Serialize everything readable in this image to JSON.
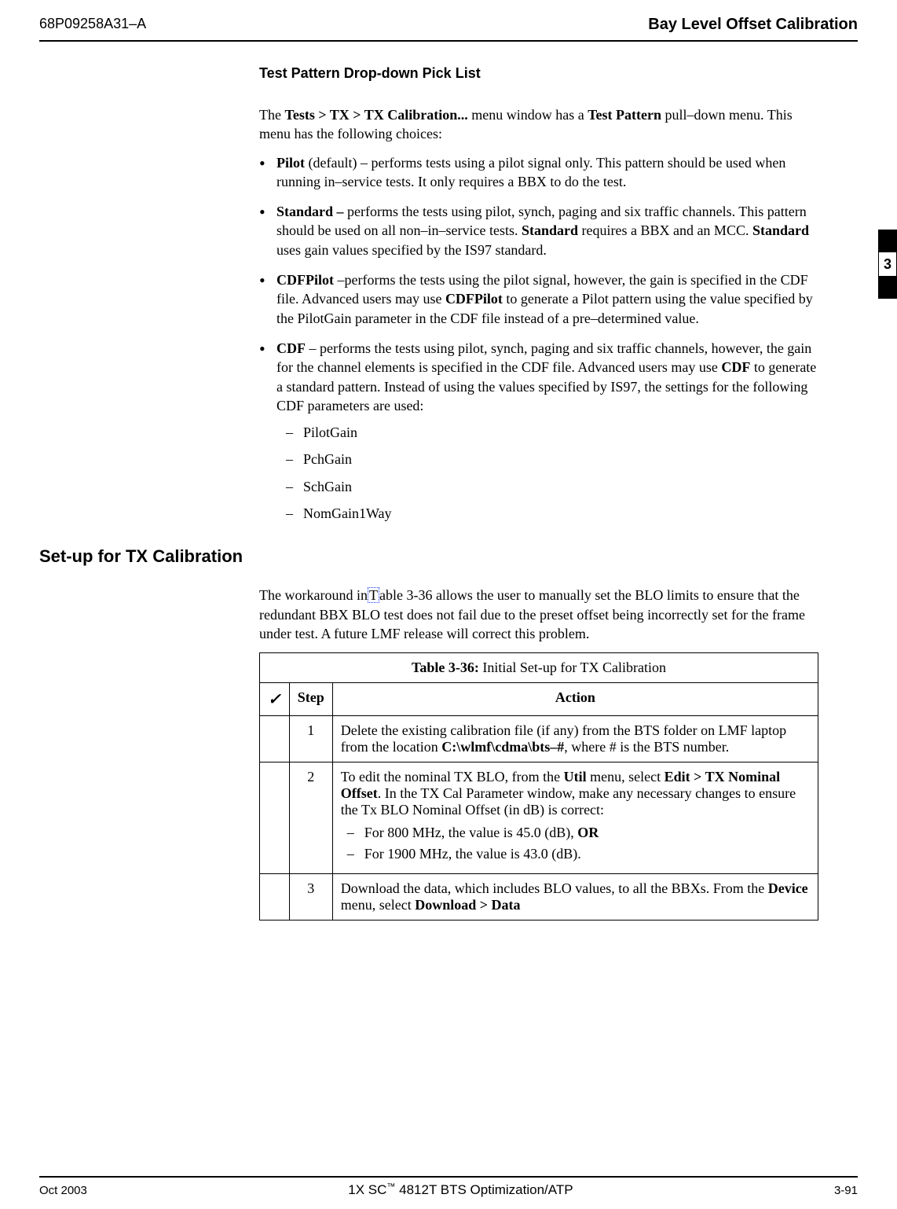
{
  "header": {
    "doc_id": "68P09258A31–A",
    "title": "Bay Level Offset Calibration"
  },
  "sideTab": {
    "number": "3"
  },
  "subsection1": {
    "title": "Test Pattern Drop-down Pick List",
    "intro_parts": {
      "p1": "The ",
      "menu_path": "Tests > TX > TX Calibration...",
      "p2": " menu window has a ",
      "param": "Test Pattern",
      "p3": " pull–down menu. This menu has the following choices:"
    },
    "bullets": {
      "pilot_label": "Pilot",
      "pilot_text": " (default) – performs tests using a pilot signal only. This pattern should be used when running in–service tests. It only requires a BBX to do the test.",
      "standard_label": "Standard –",
      "standard_text1": " performs the tests using pilot, synch, paging and six traffic channels. This pattern should be used on all non–in–service tests. ",
      "standard_req": "Standard",
      "standard_text2": " requires a BBX and an MCC. ",
      "standard_uses": "Standard",
      "standard_text3": " uses gain values specified by the IS97 standard.",
      "cdfpilot_label": "CDFPilot",
      "cdfpilot_text1": " –performs the tests using the pilot signal, however, the gain is specified in the CDF file. Advanced users may use ",
      "cdfpilot_b2": "CDFPilot",
      "cdfpilot_text2": " to generate a Pilot pattern using the value specified by the PilotGain parameter in the CDF file instead of a pre–determined value.",
      "cdf_label": "CDF",
      "cdf_text1": " – performs the tests using pilot, synch, paging and six traffic channels, however, the gain for the channel elements is specified in the CDF file. Advanced users may use ",
      "cdf_b2": "CDF",
      "cdf_text2": " to generate a standard pattern. Instead of using the values specified by IS97, the settings for the following CDF parameters are used:",
      "params": {
        "p1": "PilotGain",
        "p2": "PchGain",
        "p3": "SchGain",
        "p4": "NomGain1Way"
      }
    }
  },
  "section2": {
    "title": "Set-up for TX Calibration",
    "intro_p1": "The workaround in",
    "intro_ref_prefix": " T",
    "intro_p2": "able 3-36 allows the user to manually set the BLO limits to ensure that the redundant BBX BLO test does not fail due to the preset offset being incorrectly set for the frame under test. A future LMF release will correct this problem."
  },
  "table": {
    "caption_bold": "Table 3-36:",
    "caption_rest": " Initial Set-up for TX Calibration",
    "check_symbol": "✓",
    "step_header": "Step",
    "action_header": "Action",
    "rows": {
      "r1": {
        "step": "1",
        "text1": "Delete the existing calibration file (if any) from the BTS folder on LMF laptop from the location ",
        "path": "C:\\wlmf\\cdma\\bts–#",
        "text2": ", where # is the BTS number."
      },
      "r2": {
        "step": "2",
        "text1": "To edit the nominal TX BLO, from the ",
        "menu1": "Util",
        "text2": " menu, select ",
        "menu2": "Edit > TX Nominal Offset",
        "text3": ".  In the TX Cal Parameter window, make any necessary changes to ensure the Tx BLO Nominal Offset (in dB) is correct:",
        "d1a": "For 800 MHz, the value is 45.0 (dB), ",
        "d1b": "OR",
        "d2": "For 1900 MHz, the value is 43.0 (dB)."
      },
      "r3": {
        "step": "3",
        "text1": "Download the data, which includes BLO values, to all the BBXs. From the ",
        "menu1": "Device",
        "text2": " menu, select  ",
        "menu2": "Download > Data"
      }
    }
  },
  "footer": {
    "date": "Oct 2003",
    "center_pre": "1X SC",
    "center_tm": "™",
    "center_post": " 4812T BTS Optimization/ATP",
    "page": "3-91"
  }
}
